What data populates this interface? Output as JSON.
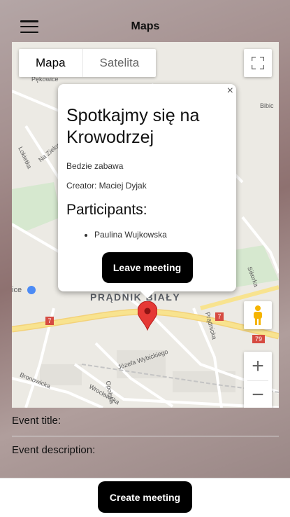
{
  "header": {
    "title": "Maps"
  },
  "map": {
    "type_buttons": [
      "Mapa",
      "Satelita"
    ],
    "district_label": "PRĄDNIK BIAŁY",
    "place_labels": [
      "Pękowice",
      "Bibic",
      "Lokietka",
      "Na Zielonki",
      "ice",
      "Józefa Wybickiego",
      "Bronowicka",
      "Wrocławska",
      "Prądnicka",
      "Opolska",
      "Sikorka"
    ],
    "road_numbers": [
      "7",
      "7",
      "79"
    ]
  },
  "info_window": {
    "title": "Spotkajmy się na Krowodrzej",
    "description": "Bedzie zabawa",
    "creator": "Creator: Maciej Dyjak",
    "participants_heading": "Participants:",
    "participants": [
      "Paulina Wujkowska"
    ],
    "leave_button": "Leave meeting",
    "close_glyph": "×"
  },
  "form": {
    "event_title_label": "Event title:",
    "event_title_value": "",
    "event_description_label": "Event description:",
    "event_description_value": "",
    "create_button": "Create meeting"
  },
  "colors": {
    "marker": "#e53935",
    "road_yellow": "#f8e38f",
    "map_bg": "#eceae4"
  }
}
